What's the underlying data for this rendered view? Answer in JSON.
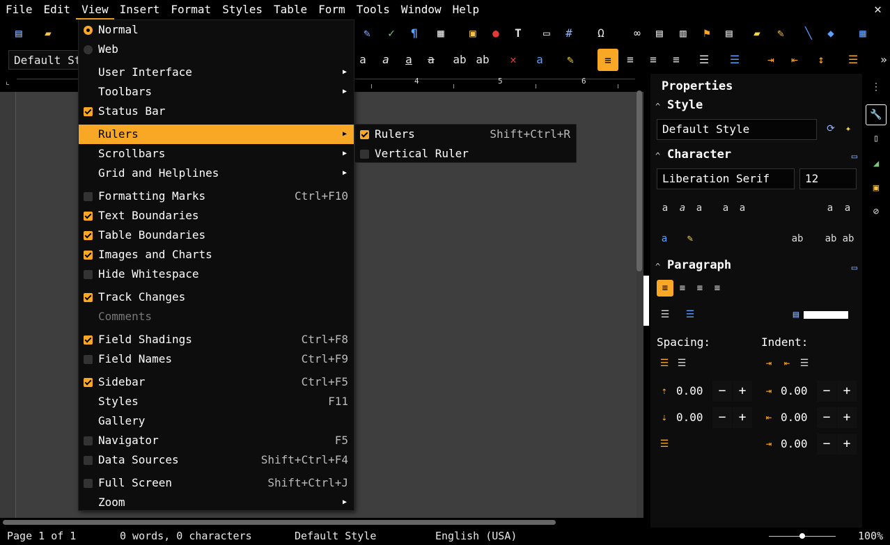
{
  "menubar": {
    "items": [
      "File",
      "Edit",
      "View",
      "Insert",
      "Format",
      "Styles",
      "Table",
      "Form",
      "Tools",
      "Window",
      "Help"
    ],
    "close": "✕"
  },
  "toolbar": {
    "paragraph_style": "Default St"
  },
  "ruler": {
    "numbers": [
      "4",
      "5",
      "6"
    ]
  },
  "view_menu": {
    "normal": "Normal",
    "web": "Web",
    "user_interface": "User Interface",
    "toolbars": "Toolbars",
    "status_bar": "Status Bar",
    "rulers": "Rulers",
    "scrollbars": "Scrollbars",
    "grid_helplines": "Grid and Helplines",
    "formatting_marks": "Formatting Marks",
    "formatting_marks_sc": "Ctrl+F10",
    "text_boundaries": "Text Boundaries",
    "table_boundaries": "Table Boundaries",
    "images_charts": "Images and Charts",
    "hide_whitespace": "Hide Whitespace",
    "track_changes": "Track Changes",
    "comments": "Comments",
    "field_shadings": "Field Shadings",
    "field_shadings_sc": "Ctrl+F8",
    "field_names": "Field Names",
    "field_names_sc": "Ctrl+F9",
    "sidebar": "Sidebar",
    "sidebar_sc": "Ctrl+F5",
    "styles": "Styles",
    "styles_sc": "F11",
    "gallery": "Gallery",
    "navigator": "Navigator",
    "navigator_sc": "F5",
    "data_sources": "Data Sources",
    "data_sources_sc": "Shift+Ctrl+F4",
    "full_screen": "Full Screen",
    "full_screen_sc": "Shift+Ctrl+J",
    "zoom": "Zoom"
  },
  "rulers_submenu": {
    "rulers": "Rulers",
    "rulers_sc": "Shift+Ctrl+R",
    "vertical_ruler": "Vertical Ruler"
  },
  "sidebar": {
    "title": "Properties",
    "style_header": "Style",
    "style_value": "Default Style",
    "character_header": "Character",
    "font_name": "Liberation Serif",
    "font_size": "12",
    "paragraph_header": "Paragraph",
    "spacing_label": "Spacing:",
    "indent_label": "Indent:",
    "above_spacing": "0.00",
    "below_spacing": "0.00",
    "before_indent": "0.00",
    "after_indent": "0.00",
    "first_line_indent": "0.00",
    "minus": "−",
    "plus": "+"
  },
  "statusbar": {
    "page": "Page 1 of 1",
    "words": "0 words, 0 characters",
    "style": "Default Style",
    "language": "English (USA)",
    "zoom": "100%"
  },
  "colors": {
    "accent": "#f9a825",
    "menubar_bg": "#000000",
    "menu_bg": "#0d0d0d"
  }
}
